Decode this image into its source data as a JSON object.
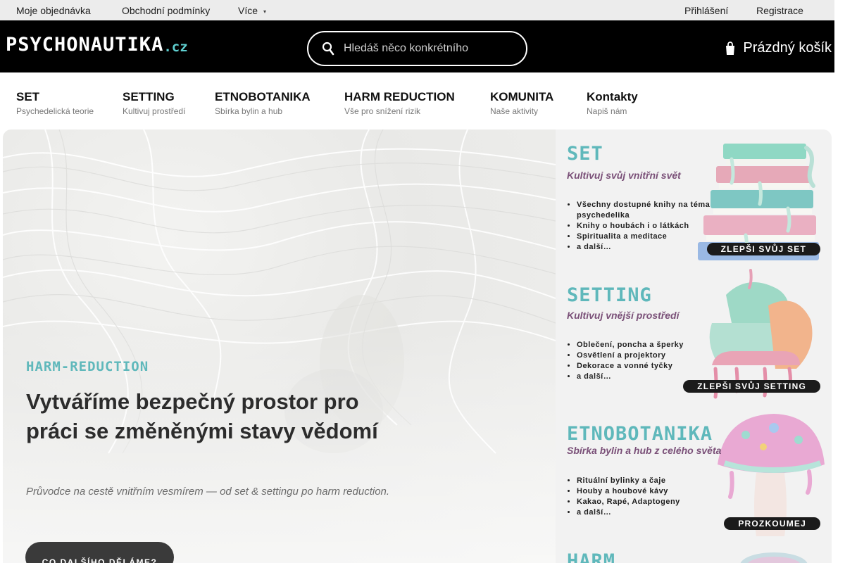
{
  "topbar": {
    "links": [
      {
        "label": "Moje objednávka"
      },
      {
        "label": "Obchodní podmínky"
      },
      {
        "label": "Více"
      }
    ],
    "right_links": [
      {
        "label": "Přihlášení"
      },
      {
        "label": "Registrace"
      }
    ]
  },
  "header": {
    "logo_main": "PSYCHONAUTIKA",
    "logo_tld": ".cz",
    "search": {
      "placeholder": "Hledáš něco konkrétního"
    },
    "cart_label": "Prázdný košík"
  },
  "nav": {
    "items": [
      {
        "title": "SET",
        "subtitle": "Psychedelická teorie"
      },
      {
        "title": "SETTING",
        "subtitle": "Kultivuj prostředí"
      },
      {
        "title": "ETNOBOTANIKA",
        "subtitle": "Sbírka bylin a hub"
      },
      {
        "title": "HARM REDUCTION",
        "subtitle": "Vše pro snížení rizik"
      },
      {
        "title": "KOMUNITA",
        "subtitle": "Naše aktivity"
      },
      {
        "title": "Kontakty",
        "subtitle": "Napiš nám"
      }
    ]
  },
  "hero": {
    "kicker": "HARM-REDUCTION",
    "title": "Vytváříme bezpečný prostor pro práci se změněnými stavy vědomí",
    "subtitle": "Průvodce na cestě vnitřním vesmírem — od set & settingu po harm reduction.",
    "button_label": "CO DALŠÍHO DĚLÁME?"
  },
  "cards": [
    {
      "title": "SET",
      "subtitle": "Kultivuj svůj vnitřní svět",
      "items": [
        "Všechny dostupné knihy na téma psychedelika",
        "Knihy o houbách i o látkách",
        "Spiritualita a meditace",
        "a další…"
      ],
      "button_label": "ZLEPŠI SVŮJ SET"
    },
    {
      "title": "SETTING",
      "subtitle": "Kultivuj vnější prostředí",
      "items": [
        "Oblečení, poncha a šperky",
        "Osvětlení a projektory",
        "Dekorace a vonné tyčky",
        "a další…"
      ],
      "button_label": "ZLEPŠI SVŮJ SETTING"
    },
    {
      "title": "ETNOBOTANIKA",
      "subtitle": "Sbírka bylin a hub z celého světa",
      "items": [
        "Rituální bylinky a čaje",
        "Houby a houbové kávy",
        "Kakao, Rapé, Adaptogeny",
        "a další…"
      ],
      "button_label": "PROZKOUMEJ"
    },
    {
      "title": "HARM"
    }
  ],
  "colors": {
    "accent_teal": "#5fb8bb",
    "subtitle_purple": "#7a5078",
    "header_black": "#000000",
    "topbar_gray": "#ececec"
  },
  "icons": {
    "search": "search-icon",
    "cart": "cart-icon",
    "more_caret": "caret-down-icon"
  }
}
